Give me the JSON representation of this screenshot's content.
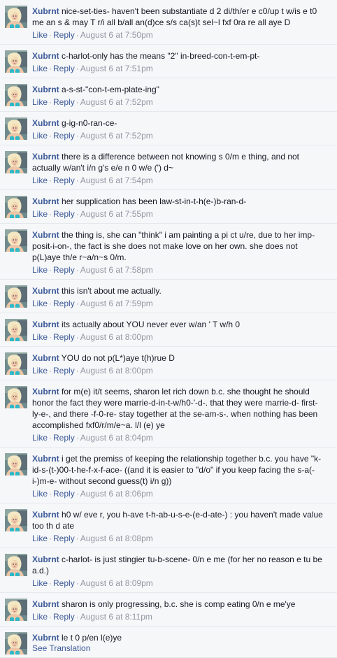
{
  "like_label": "Like",
  "reply_label": "Reply",
  "separator": "·",
  "see_translation_label": "See Translation",
  "avatar_icon": "profile-photo-icon",
  "comments": [
    {
      "author": "Xubrnt",
      "text": "nice-set-ties- haven't been substantiate d 2 di/th/er e c0/up t w/is e t0 me an s & may T r/i all b/all an(d)ce s/s ca(s)t sel~l fxf 0ra re all aye D",
      "time": "August 6 at 7:50pm"
    },
    {
      "author": "Xubrnt",
      "text": "c-harlot-only has the means \"2\" in-breed-con-t-em-pt-",
      "time": "August 6 at 7:51pm"
    },
    {
      "author": "Xubrnt",
      "text": "a-s-st-\"con-t-em-plate-ing\"",
      "time": "August 6 at 7:52pm"
    },
    {
      "author": "Xubrnt",
      "text": "g-ig-n0-ran-ce-",
      "time": "August 6 at 7:52pm"
    },
    {
      "author": "Xubrnt",
      "text": "there is a difference between not knowing s 0/m e thing, and not actually w/an't i/n g's e/e n 0 w/e (') d~",
      "time": "August 6 at 7:54pm"
    },
    {
      "author": "Xubrnt",
      "text": "her supplication has been law-st-in-t-h(e-)b-ran-d-",
      "time": "August 6 at 7:55pm"
    },
    {
      "author": "Xubrnt",
      "text": "the thing is, she can \"think\" i am painting a pi ct u/re, due to her imp-posit-i-on-, the fact is she does not make love on her own. she does not p(L)aye th/e r~a/n~s 0/m.",
      "time": "August 6 at 7:58pm"
    },
    {
      "author": "Xubrnt",
      "text": "this isn't about me actually.",
      "time": "August 6 at 7:59pm"
    },
    {
      "author": "Xubrnt",
      "text": "its actually about YOU never ever w/an ' T w/h 0",
      "time": "August 6 at 8:00pm"
    },
    {
      "author": "Xubrnt",
      "text": "YOU do not p(L*)aye t(h)rue D",
      "time": "August 6 at 8:00pm"
    },
    {
      "author": "Xubrnt",
      "text": "for m(e) it/t seems, sharon let rich down b.c. she thought he should honor the fact they were marrie-d-in-t-w/h0-'-d-. that they were marrie-d- first-ly-e-, and there -f-0-re- stay together at the se-am-s-. when nothing has been accomplished fxf0/r/m/e~a. l/l (e) ye",
      "time": "August 6 at 8:04pm"
    },
    {
      "author": "Xubrnt",
      "text": "i get the premiss of keeping the relationship together b.c. you have \"k-id-s-(t-)00-t-he-f-x-f-ace- ((and it is easier to \"d/o\" if you keep facing the s-a(-i-)m-e- without second guess(t) i/n g))",
      "time": "August 6 at 8:06pm"
    },
    {
      "author": "Xubrnt",
      "text": "h0 w/ eve r, you h-ave t-h-ab-u-s-e-(e-d-ate-) : you haven't made value too th d ate",
      "time": "August 6 at 8:08pm"
    },
    {
      "author": "Xubrnt",
      "text": "c-harlot- is just stingier tu-b-scene- 0/n e me (for her no reason e tu be a.d.)",
      "time": "August 6 at 8:09pm"
    },
    {
      "author": "Xubrnt",
      "text": "sharon is only progressing, b.c. she is comp eating 0/n e me'ye",
      "time": "August 6 at 8:11pm"
    },
    {
      "author": "Xubrnt",
      "text": "le t 0 p/en l(e)ye",
      "time": "",
      "see_translation": true
    }
  ]
}
